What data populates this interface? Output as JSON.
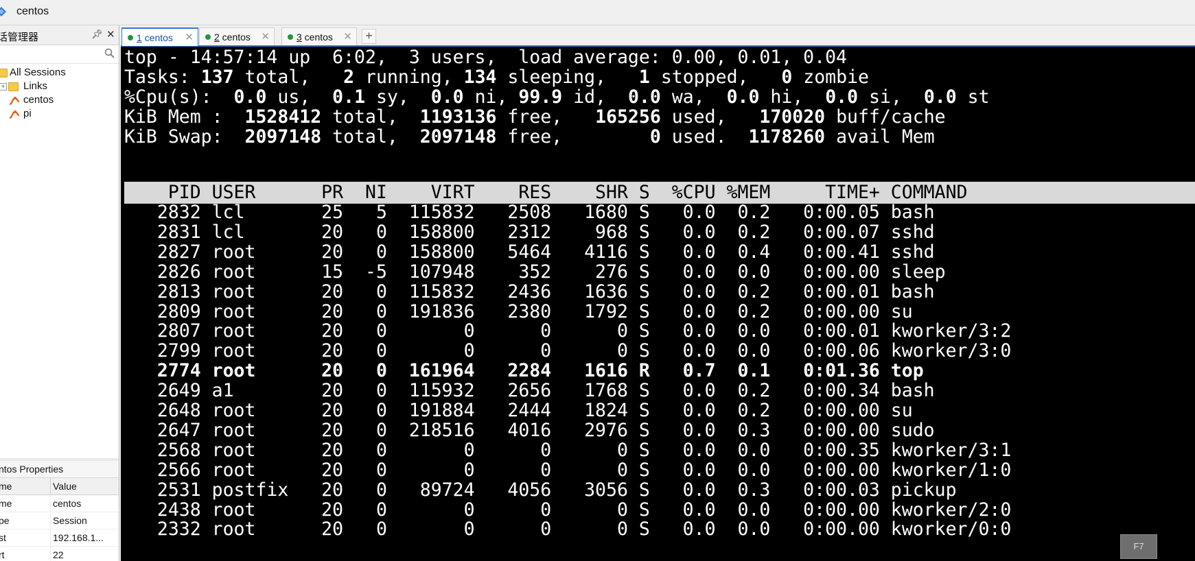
{
  "window": {
    "title": "centos"
  },
  "session_manager": {
    "title": "话管理器",
    "filter_placeholder": "",
    "tree": [
      {
        "label": "All Sessions",
        "kind": "root"
      },
      {
        "label": "Links",
        "kind": "folder"
      },
      {
        "label": "centos",
        "kind": "session"
      },
      {
        "label": "pi",
        "kind": "session"
      }
    ]
  },
  "properties": {
    "title": "ntos Properties",
    "col_name": "me",
    "col_value": "Value",
    "rows": [
      {
        "name": "me",
        "value": "centos"
      },
      {
        "name": "pe",
        "value": "Session"
      },
      {
        "name": "st",
        "value": "192.168.1..."
      },
      {
        "name": "rt",
        "value": "22"
      }
    ]
  },
  "tabs": [
    {
      "num": "1",
      "label": " centos",
      "active": true
    },
    {
      "num": "2",
      "label": " centos",
      "active": false
    },
    {
      "num": "3",
      "label": " centos",
      "active": false
    }
  ],
  "new_tab_label": "+",
  "terminal": {
    "summary": [
      [
        {
          "t": "top - 14:57:14 up  6:02,  3 users,  load average: 0.00, 0.01, 0.04",
          "b": false
        }
      ],
      [
        {
          "t": "Tasks: ",
          "b": false
        },
        {
          "t": "137",
          "b": true
        },
        {
          "t": " total,   ",
          "b": false
        },
        {
          "t": "2",
          "b": true
        },
        {
          "t": " running, ",
          "b": false
        },
        {
          "t": "134",
          "b": true
        },
        {
          "t": " sleeping,   ",
          "b": false
        },
        {
          "t": "1",
          "b": true
        },
        {
          "t": " stopped,   ",
          "b": false
        },
        {
          "t": "0",
          "b": true
        },
        {
          "t": " zombie",
          "b": false
        }
      ],
      [
        {
          "t": "%Cpu(s):  ",
          "b": false
        },
        {
          "t": "0.0",
          "b": true
        },
        {
          "t": " us,  ",
          "b": false
        },
        {
          "t": "0.1",
          "b": true
        },
        {
          "t": " sy,  ",
          "b": false
        },
        {
          "t": "0.0",
          "b": true
        },
        {
          "t": " ni, ",
          "b": false
        },
        {
          "t": "99.9",
          "b": true
        },
        {
          "t": " id,  ",
          "b": false
        },
        {
          "t": "0.0",
          "b": true
        },
        {
          "t": " wa,  ",
          "b": false
        },
        {
          "t": "0.0",
          "b": true
        },
        {
          "t": " hi,  ",
          "b": false
        },
        {
          "t": "0.0",
          "b": true
        },
        {
          "t": " si,  ",
          "b": false
        },
        {
          "t": "0.0",
          "b": true
        },
        {
          "t": " st",
          "b": false
        }
      ],
      [
        {
          "t": "KiB Mem :  ",
          "b": false
        },
        {
          "t": "1528412",
          "b": true
        },
        {
          "t": " total,  ",
          "b": false
        },
        {
          "t": "1193136",
          "b": true
        },
        {
          "t": " free,   ",
          "b": false
        },
        {
          "t": "165256",
          "b": true
        },
        {
          "t": " used,   ",
          "b": false
        },
        {
          "t": "170020",
          "b": true
        },
        {
          "t": " buff/cache",
          "b": false
        }
      ],
      [
        {
          "t": "KiB Swap:  ",
          "b": false
        },
        {
          "t": "2097148",
          "b": true
        },
        {
          "t": " total,  ",
          "b": false
        },
        {
          "t": "2097148",
          "b": true
        },
        {
          "t": " free,        ",
          "b": false
        },
        {
          "t": "0",
          "b": true
        },
        {
          "t": " used.  ",
          "b": false
        },
        {
          "t": "1178260",
          "b": true
        },
        {
          "t": " avail Mem",
          "b": false
        }
      ]
    ],
    "columns": [
      "PID",
      "USER",
      "PR",
      "NI",
      "VIRT",
      "RES",
      "SHR",
      "S",
      "%CPU",
      "%MEM",
      "TIME+",
      "COMMAND"
    ],
    "processes": [
      [
        "2832",
        "lcl",
        "25",
        "5",
        "115832",
        "2508",
        "1680",
        "S",
        "0.0",
        "0.2",
        "0:00.05",
        "bash"
      ],
      [
        "2831",
        "lcl",
        "20",
        "0",
        "158800",
        "2312",
        "968",
        "S",
        "0.0",
        "0.2",
        "0:00.07",
        "sshd"
      ],
      [
        "2827",
        "root",
        "20",
        "0",
        "158800",
        "5464",
        "4116",
        "S",
        "0.0",
        "0.4",
        "0:00.41",
        "sshd"
      ],
      [
        "2826",
        "root",
        "15",
        "-5",
        "107948",
        "352",
        "276",
        "S",
        "0.0",
        "0.0",
        "0:00.00",
        "sleep"
      ],
      [
        "2813",
        "root",
        "20",
        "0",
        "115832",
        "2436",
        "1636",
        "S",
        "0.0",
        "0.2",
        "0:00.01",
        "bash"
      ],
      [
        "2809",
        "root",
        "20",
        "0",
        "191836",
        "2380",
        "1792",
        "S",
        "0.0",
        "0.2",
        "0:00.00",
        "su"
      ],
      [
        "2807",
        "root",
        "20",
        "0",
        "0",
        "0",
        "0",
        "S",
        "0.0",
        "0.0",
        "0:00.01",
        "kworker/3:2"
      ],
      [
        "2799",
        "root",
        "20",
        "0",
        "0",
        "0",
        "0",
        "S",
        "0.0",
        "0.0",
        "0:00.06",
        "kworker/3:0"
      ],
      [
        "2774",
        "root",
        "20",
        "0",
        "161964",
        "2284",
        "1616",
        "R",
        "0.7",
        "0.1",
        "0:01.36",
        "top"
      ],
      [
        "2649",
        "a1",
        "20",
        "0",
        "115932",
        "2656",
        "1768",
        "S",
        "0.0",
        "0.2",
        "0:00.34",
        "bash"
      ],
      [
        "2648",
        "root",
        "20",
        "0",
        "191884",
        "2444",
        "1824",
        "S",
        "0.0",
        "0.2",
        "0:00.00",
        "su"
      ],
      [
        "2647",
        "root",
        "20",
        "0",
        "218516",
        "4016",
        "2976",
        "S",
        "0.0",
        "0.3",
        "0:00.00",
        "sudo"
      ],
      [
        "2568",
        "root",
        "20",
        "0",
        "0",
        "0",
        "0",
        "S",
        "0.0",
        "0.0",
        "0:00.35",
        "kworker/3:1"
      ],
      [
        "2566",
        "root",
        "20",
        "0",
        "0",
        "0",
        "0",
        "S",
        "0.0",
        "0.0",
        "0:00.00",
        "kworker/1:0"
      ],
      [
        "2531",
        "postfix",
        "20",
        "0",
        "89724",
        "4056",
        "3056",
        "S",
        "0.0",
        "0.3",
        "0:00.03",
        "pickup"
      ],
      [
        "2438",
        "root",
        "20",
        "0",
        "0",
        "0",
        "0",
        "S",
        "0.0",
        "0.0",
        "0:00.00",
        "kworker/2:0"
      ],
      [
        "2332",
        "root",
        "20",
        "0",
        "0",
        "0",
        "0",
        "S",
        "0.0",
        "0.0",
        "0:00.00",
        "kworker/0:0"
      ]
    ],
    "running_state": "R"
  },
  "f7_label": "F7"
}
